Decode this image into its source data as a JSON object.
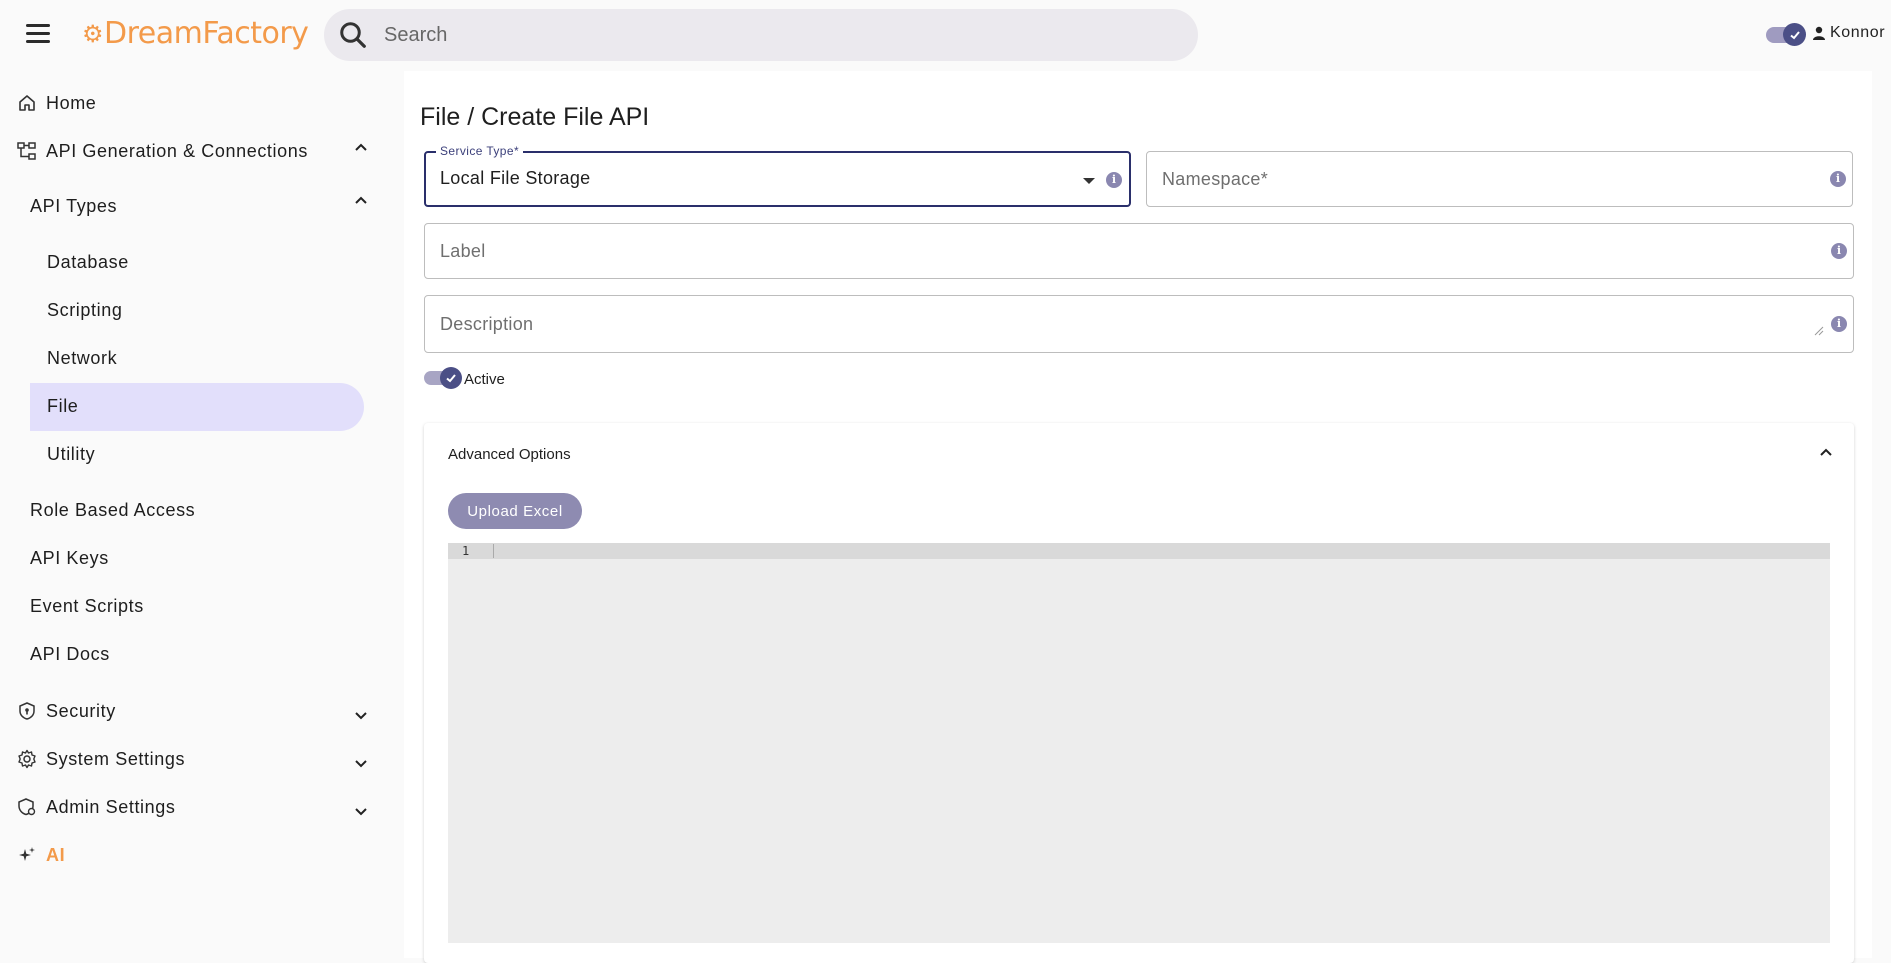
{
  "header": {
    "logo_text": "DreamFactory",
    "search_placeholder": "Search",
    "username": "Konnor"
  },
  "sidebar": {
    "items": [
      {
        "label": "Home"
      },
      {
        "label": "API Generation & Connections"
      },
      {
        "label": "API Types"
      },
      {
        "label": "Database"
      },
      {
        "label": "Scripting"
      },
      {
        "label": "Network"
      },
      {
        "label": "File"
      },
      {
        "label": "Utility"
      },
      {
        "label": "Role Based Access"
      },
      {
        "label": "API Keys"
      },
      {
        "label": "Event Scripts"
      },
      {
        "label": "API Docs"
      },
      {
        "label": "Security"
      },
      {
        "label": "System Settings"
      },
      {
        "label": "Admin Settings"
      },
      {
        "label": "AI"
      }
    ],
    "active_item": "File"
  },
  "form": {
    "title": "File / Create File API",
    "service_type_label": "Service Type*",
    "service_type_value": "Local File Storage",
    "namespace_placeholder": "Namespace*",
    "label_placeholder": "Label",
    "description_placeholder": "Description",
    "active_label": "Active",
    "active_enabled": true
  },
  "advanced": {
    "title": "Advanced Options",
    "upload_button": "Upload Excel",
    "editor_line_number": "1"
  },
  "colors": {
    "brand": "#f39a4a",
    "accent": "#4b4f86",
    "active_nav_bg": "#e2dffb",
    "ai_label": "#f39a4a"
  }
}
